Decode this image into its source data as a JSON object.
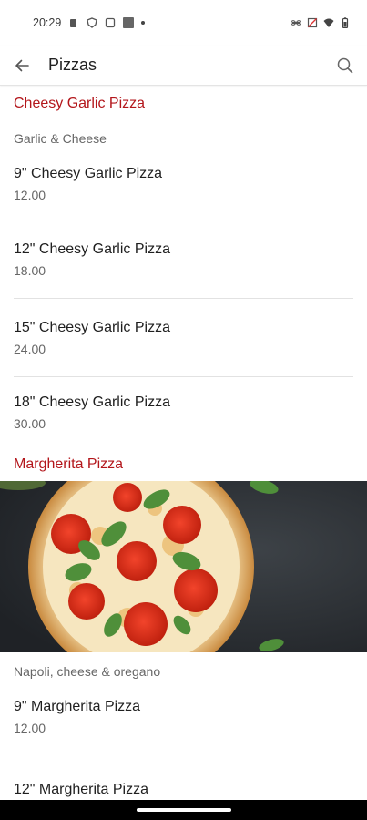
{
  "status_bar": {
    "time": "20:29"
  },
  "app_bar": {
    "title": "Pizzas"
  },
  "sections": [
    {
      "title": "Cheesy Garlic Pizza",
      "description": "Garlic & Cheese",
      "items": [
        {
          "name": "9\" Cheesy Garlic Pizza",
          "price": "12.00"
        },
        {
          "name": "12\" Cheesy Garlic Pizza",
          "price": "18.00"
        },
        {
          "name": "15\" Cheesy Garlic Pizza",
          "price": "24.00"
        },
        {
          "name": "18\" Cheesy Garlic Pizza",
          "price": "30.00"
        }
      ]
    },
    {
      "title": "Margherita Pizza",
      "description": "Napoli, cheese & oregano",
      "items": [
        {
          "name": "9\" Margherita Pizza",
          "price": "12.00"
        },
        {
          "name": "12\" Margherita Pizza",
          "price": ""
        }
      ]
    }
  ],
  "colors": {
    "accent": "#b3161b"
  },
  "icons": {
    "back": "arrow-back-icon",
    "search": "search-icon"
  }
}
